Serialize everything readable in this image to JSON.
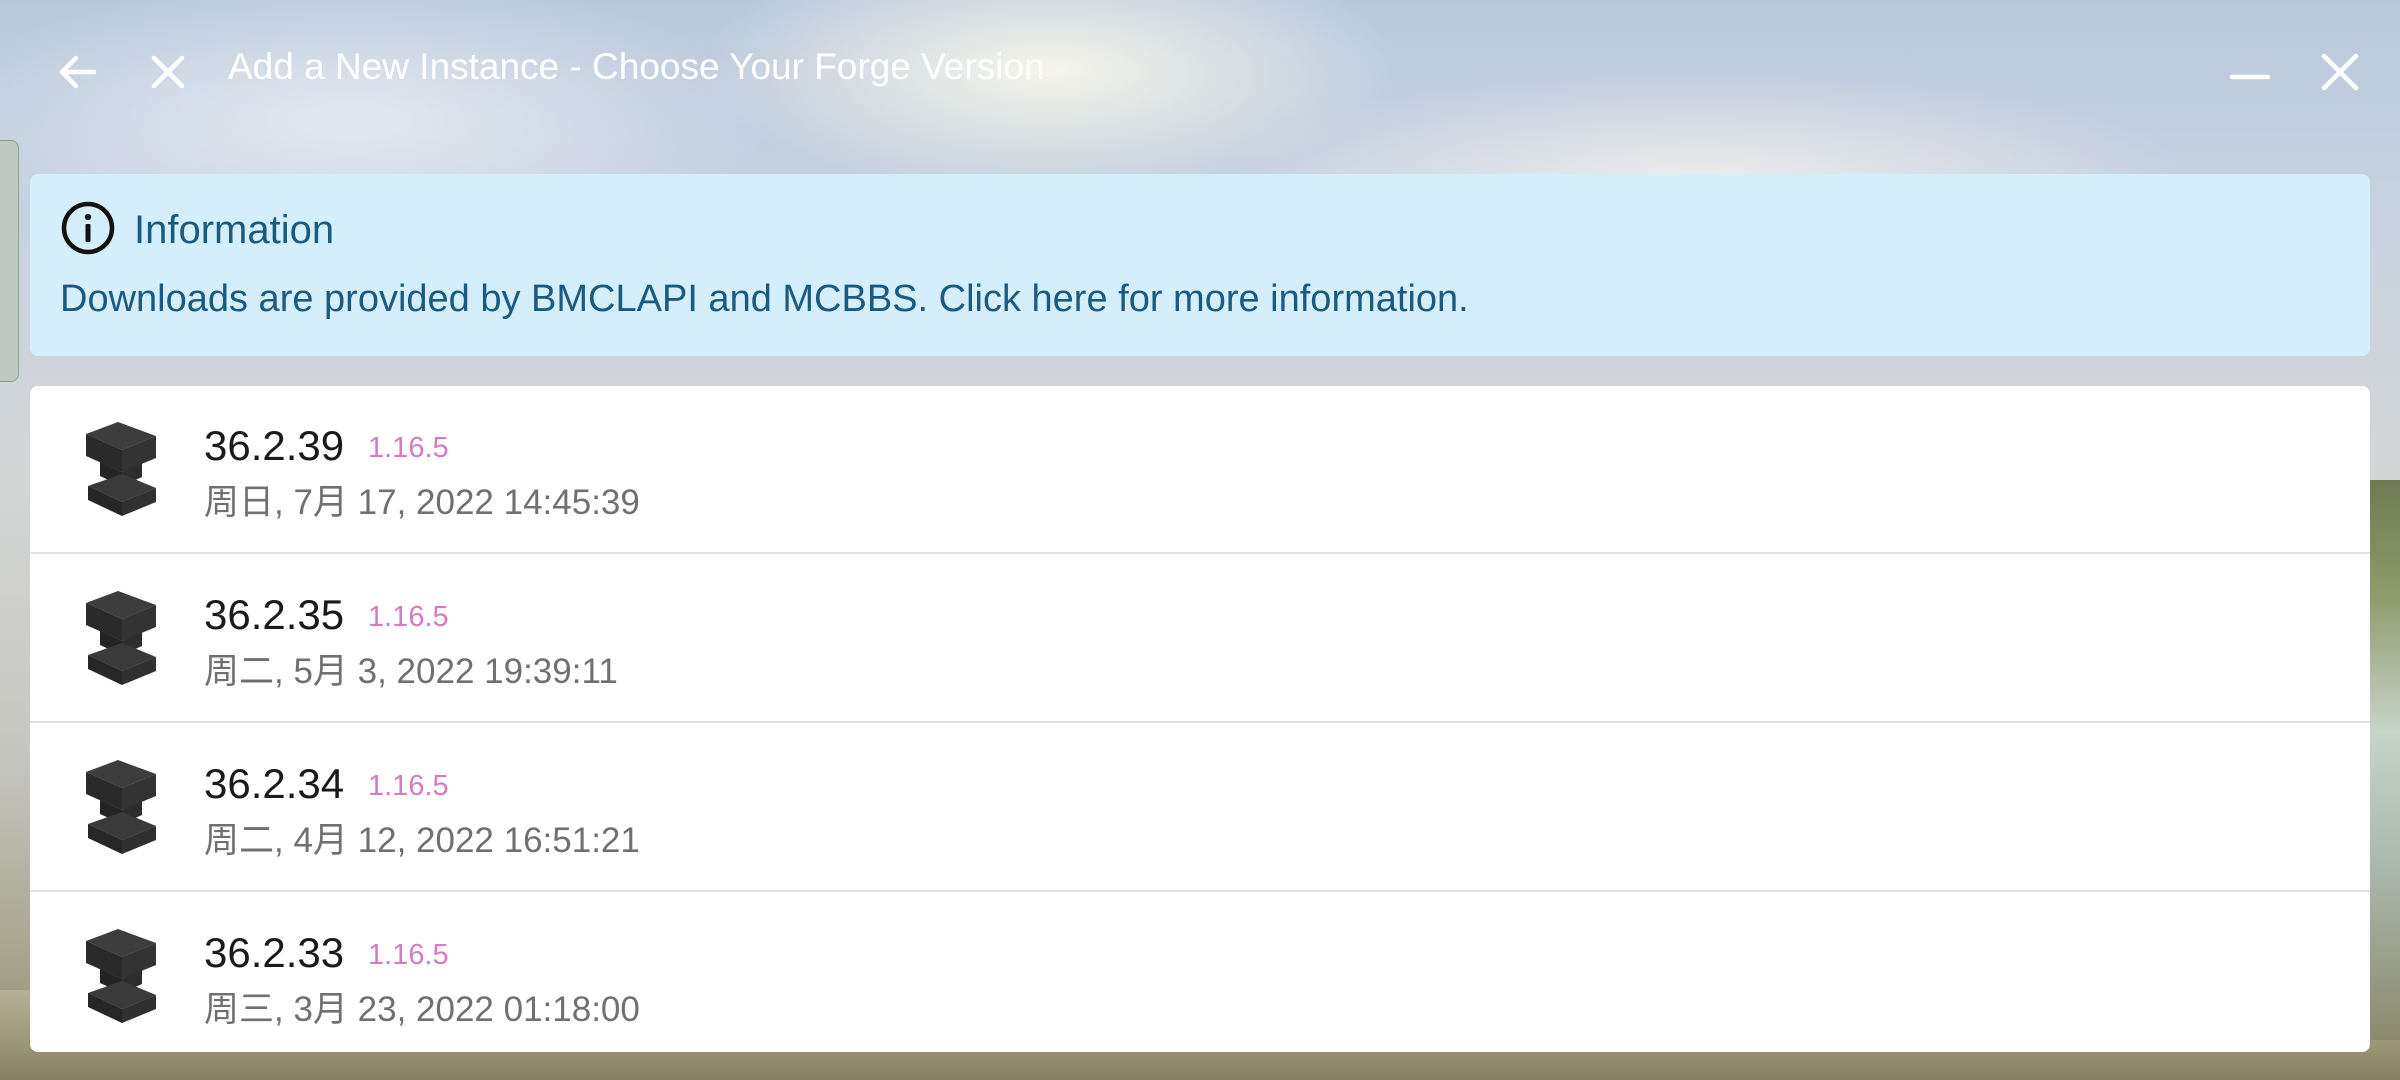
{
  "window": {
    "title": "Add a New Instance - Choose Your Forge Version"
  },
  "info": {
    "heading": "Information",
    "text": "Downloads are provided by BMCLAPI and MCBBS. Click here for more information."
  },
  "versions": [
    {
      "version": "36.2.39",
      "mc": "1.16.5",
      "date": "周日, 7月 17, 2022 14:45:39"
    },
    {
      "version": "36.2.35",
      "mc": "1.16.5",
      "date": "周二, 5月 3, 2022 19:39:11"
    },
    {
      "version": "36.2.34",
      "mc": "1.16.5",
      "date": "周二, 4月 12, 2022 16:51:21"
    },
    {
      "version": "36.2.33",
      "mc": "1.16.5",
      "date": "周三, 3月 23, 2022 01:18:00"
    }
  ],
  "icons": {
    "back": "arrow-left-icon",
    "close_page": "close-icon",
    "minimize": "minimize-icon",
    "close_window": "close-icon",
    "info": "info-circle-icon",
    "item": "anvil-icon"
  },
  "colors": {
    "info_bg": "#d4effb",
    "info_text": "#1b5a80",
    "mc_tag": "#d67bc0",
    "date_text": "#707070"
  }
}
